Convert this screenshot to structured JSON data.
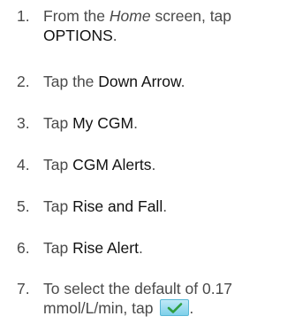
{
  "steps": [
    {
      "number": "1.",
      "parts": [
        {
          "text": "From the ",
          "style": "plain"
        },
        {
          "text": "Home",
          "style": "em"
        },
        {
          "text": " screen, tap ",
          "style": "plain"
        },
        {
          "text": "OPTIONS",
          "style": "key"
        },
        {
          "text": ".",
          "style": "plain"
        }
      ]
    },
    {
      "number": "2.",
      "parts": [
        {
          "text": "Tap the ",
          "style": "plain"
        },
        {
          "text": "Down Arrow",
          "style": "key"
        },
        {
          "text": ".",
          "style": "plain"
        }
      ]
    },
    {
      "number": "3.",
      "parts": [
        {
          "text": "Tap ",
          "style": "plain"
        },
        {
          "text": "My CGM",
          "style": "key"
        },
        {
          "text": ".",
          "style": "plain"
        }
      ]
    },
    {
      "number": "4.",
      "parts": [
        {
          "text": "Tap ",
          "style": "plain"
        },
        {
          "text": "CGM Alerts",
          "style": "key"
        },
        {
          "text": ".",
          "style": "plain"
        }
      ]
    },
    {
      "number": "5.",
      "parts": [
        {
          "text": "Tap ",
          "style": "plain"
        },
        {
          "text": "Rise and Fall",
          "style": "key"
        },
        {
          "text": ".",
          "style": "plain"
        }
      ]
    },
    {
      "number": "6.",
      "parts": [
        {
          "text": "Tap ",
          "style": "plain"
        },
        {
          "text": "Rise Alert",
          "style": "key"
        },
        {
          "text": ".",
          "style": "plain"
        }
      ]
    },
    {
      "number": "7.",
      "parts": [
        {
          "text": "To select the default of 0.17 mmol/L/min, tap ",
          "style": "plain"
        }
      ],
      "icon": "checkmark-button-icon",
      "trail": "."
    }
  ],
  "colors": {
    "text": "#4a4a4a",
    "key_text": "#111111",
    "check_button_fill": "#8fd6ee",
    "check_mark": "#2e9e3e"
  }
}
